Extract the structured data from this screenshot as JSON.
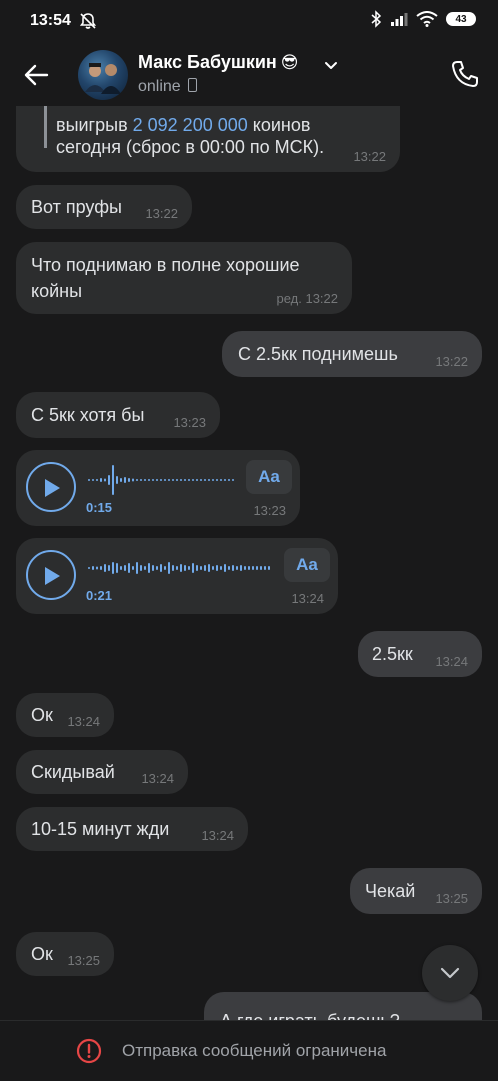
{
  "status_bar": {
    "time": "13:54",
    "battery": "43"
  },
  "header": {
    "name": "Макс Бабушкин",
    "emoji": "😎",
    "status": "online"
  },
  "messages": [
    {
      "id": "m0",
      "dir": "in",
      "text_prefix": "выигрыв ",
      "text_link": "2 092 200 000",
      "text_suffix": " коинов",
      "text_line2": "сегодня (сброс в 00:00 по МСК).",
      "time": "13:22"
    },
    {
      "id": "m1",
      "dir": "in",
      "text": "Вот пруфы",
      "time": "13:22"
    },
    {
      "id": "m2",
      "dir": "in",
      "text": "Что поднимаю в полне хорошие койны",
      "time": "ред. 13:22"
    },
    {
      "id": "m3",
      "dir": "out",
      "text": "С 2.5кк поднимешь",
      "time": "13:22"
    },
    {
      "id": "m4",
      "dir": "in",
      "text": "С 5кк хотя бы",
      "time": "13:23"
    },
    {
      "id": "m5",
      "dir": "in",
      "type": "voice",
      "duration": "0:15",
      "aa": "Aa",
      "time": "13:23"
    },
    {
      "id": "m6",
      "dir": "in",
      "type": "voice",
      "duration": "0:21",
      "aa": "Aa",
      "time": "13:24"
    },
    {
      "id": "m7",
      "dir": "out",
      "text": "2.5кк",
      "time": "13:24"
    },
    {
      "id": "m8",
      "dir": "in",
      "text": "Ок",
      "time": "13:24"
    },
    {
      "id": "m9",
      "dir": "in",
      "text": "Скидывай",
      "time": "13:24"
    },
    {
      "id": "m10",
      "dir": "in",
      "text": "10-15 минут жди",
      "time": "13:24"
    },
    {
      "id": "m11",
      "dir": "out",
      "text": "Чекай",
      "time": "13:25"
    },
    {
      "id": "m12",
      "dir": "in",
      "text": "Ок",
      "time": "13:25"
    },
    {
      "id": "m13",
      "dir": "out",
      "text": "А где играть будешь?",
      "time": ""
    }
  ],
  "bottom_bar": {
    "text": "Отправка сообщений ограничена"
  },
  "colors": {
    "accent": "#71aaeb",
    "warning": "#e64646",
    "bubble_in": "#2c2d2e",
    "bubble_out": "#3c3d40"
  }
}
